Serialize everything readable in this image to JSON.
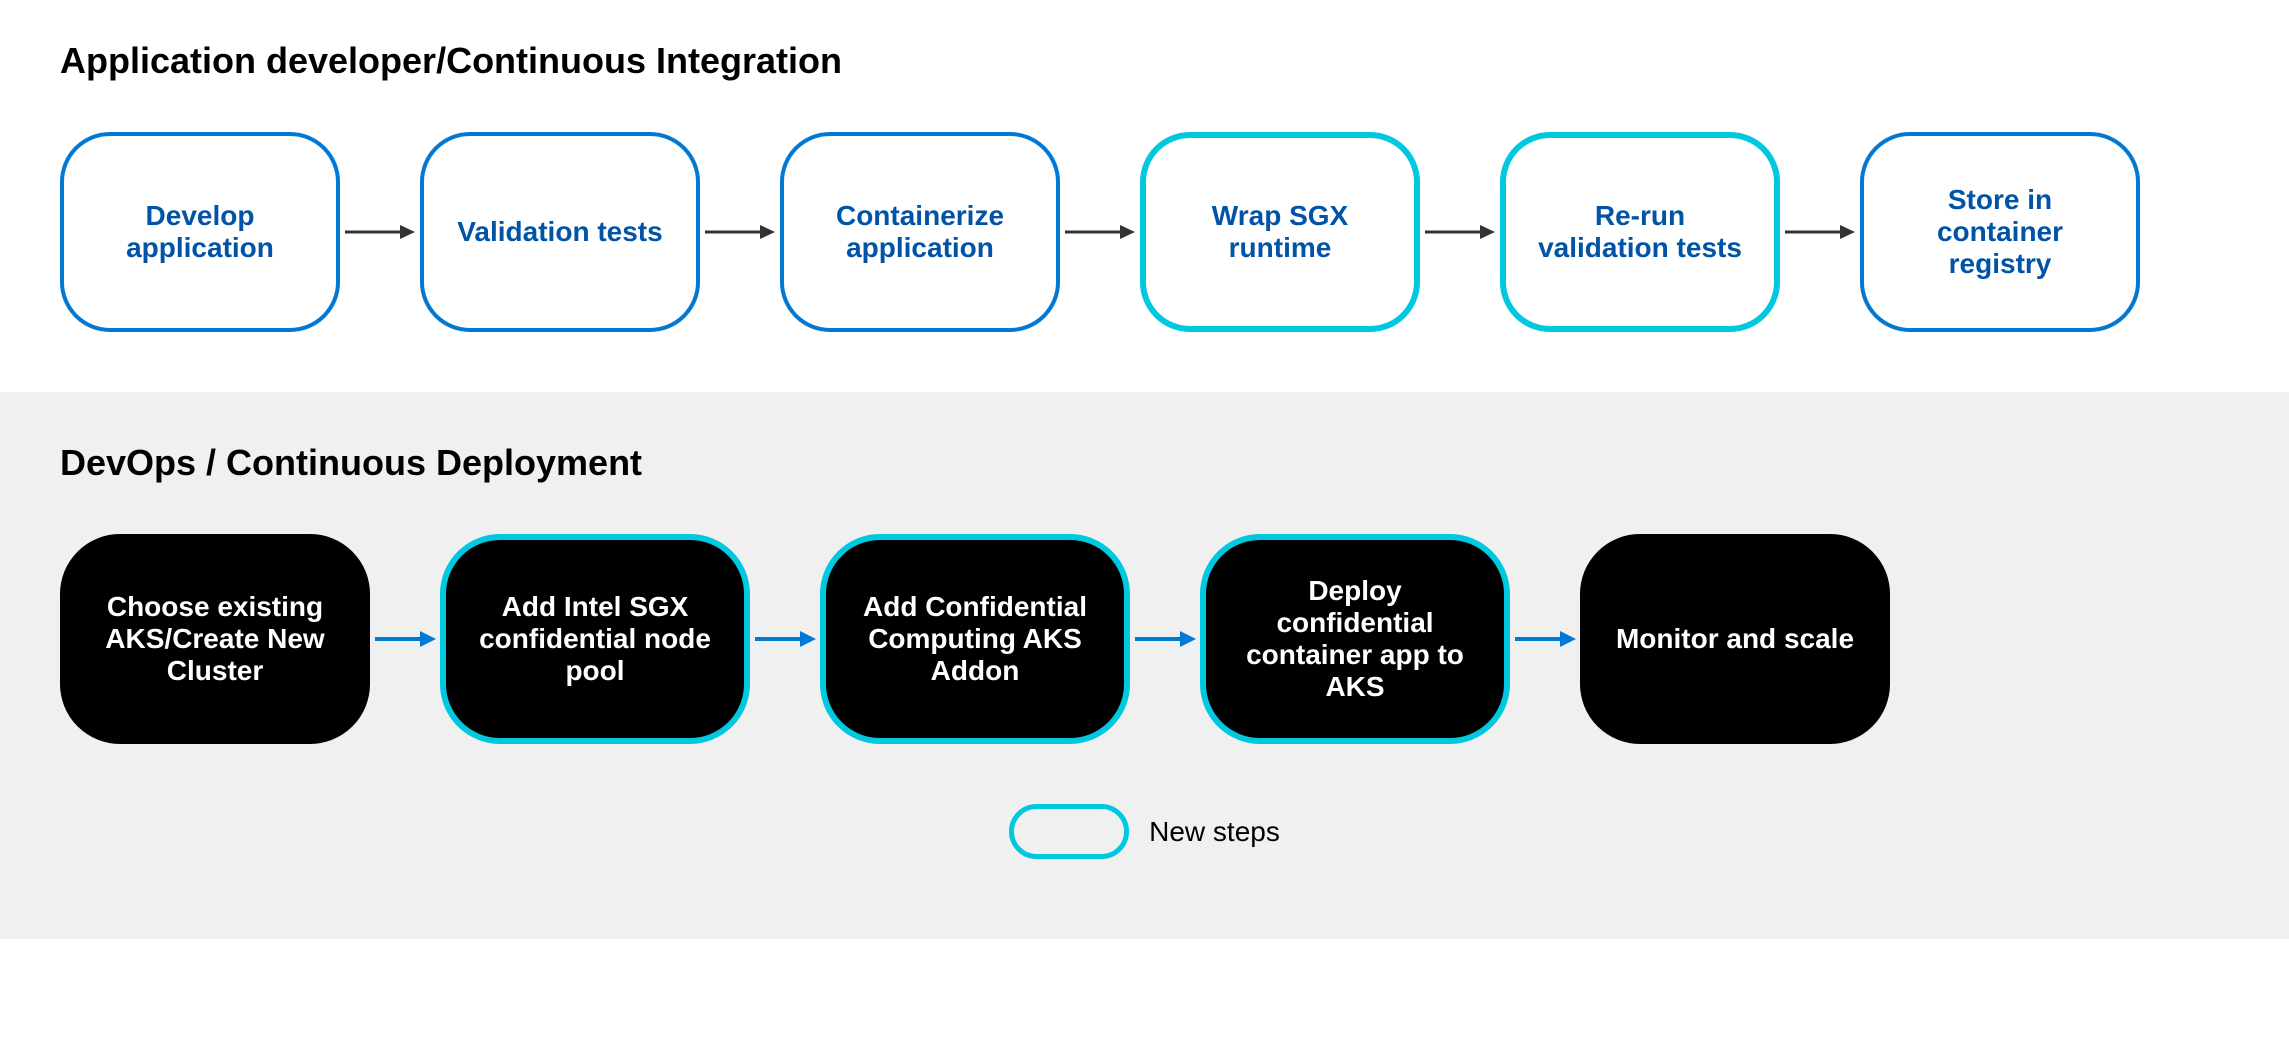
{
  "top_section": {
    "title": "Application developer/Continuous Integration",
    "nodes": [
      {
        "id": "develop-app",
        "label": "Develop application",
        "type": "normal"
      },
      {
        "id": "validation-tests",
        "label": "Validation tests",
        "type": "normal"
      },
      {
        "id": "containerize-app",
        "label": "Containerize application",
        "type": "normal"
      },
      {
        "id": "wrap-sgx",
        "label": "Wrap SGX runtime",
        "type": "cyan"
      },
      {
        "id": "rerun-validation",
        "label": "Re-run validation tests",
        "type": "cyan"
      },
      {
        "id": "store-registry",
        "label": "Store in container registry",
        "type": "normal"
      }
    ]
  },
  "bottom_section": {
    "title": "DevOps / Continuous Deployment",
    "nodes": [
      {
        "id": "choose-cluster",
        "label": "Choose existing AKS/Create New Cluster",
        "type": "normal"
      },
      {
        "id": "add-intel-sgx",
        "label": "Add Intel SGX confidential node pool",
        "type": "cyan"
      },
      {
        "id": "add-cc-addon",
        "label": "Add Confidential Computing AKS Addon",
        "type": "cyan"
      },
      {
        "id": "deploy-app",
        "label": "Deploy confidential container app to AKS",
        "type": "cyan"
      },
      {
        "id": "monitor-scale",
        "label": "Monitor and scale",
        "type": "normal"
      }
    ]
  },
  "legend": {
    "label": "New steps"
  }
}
